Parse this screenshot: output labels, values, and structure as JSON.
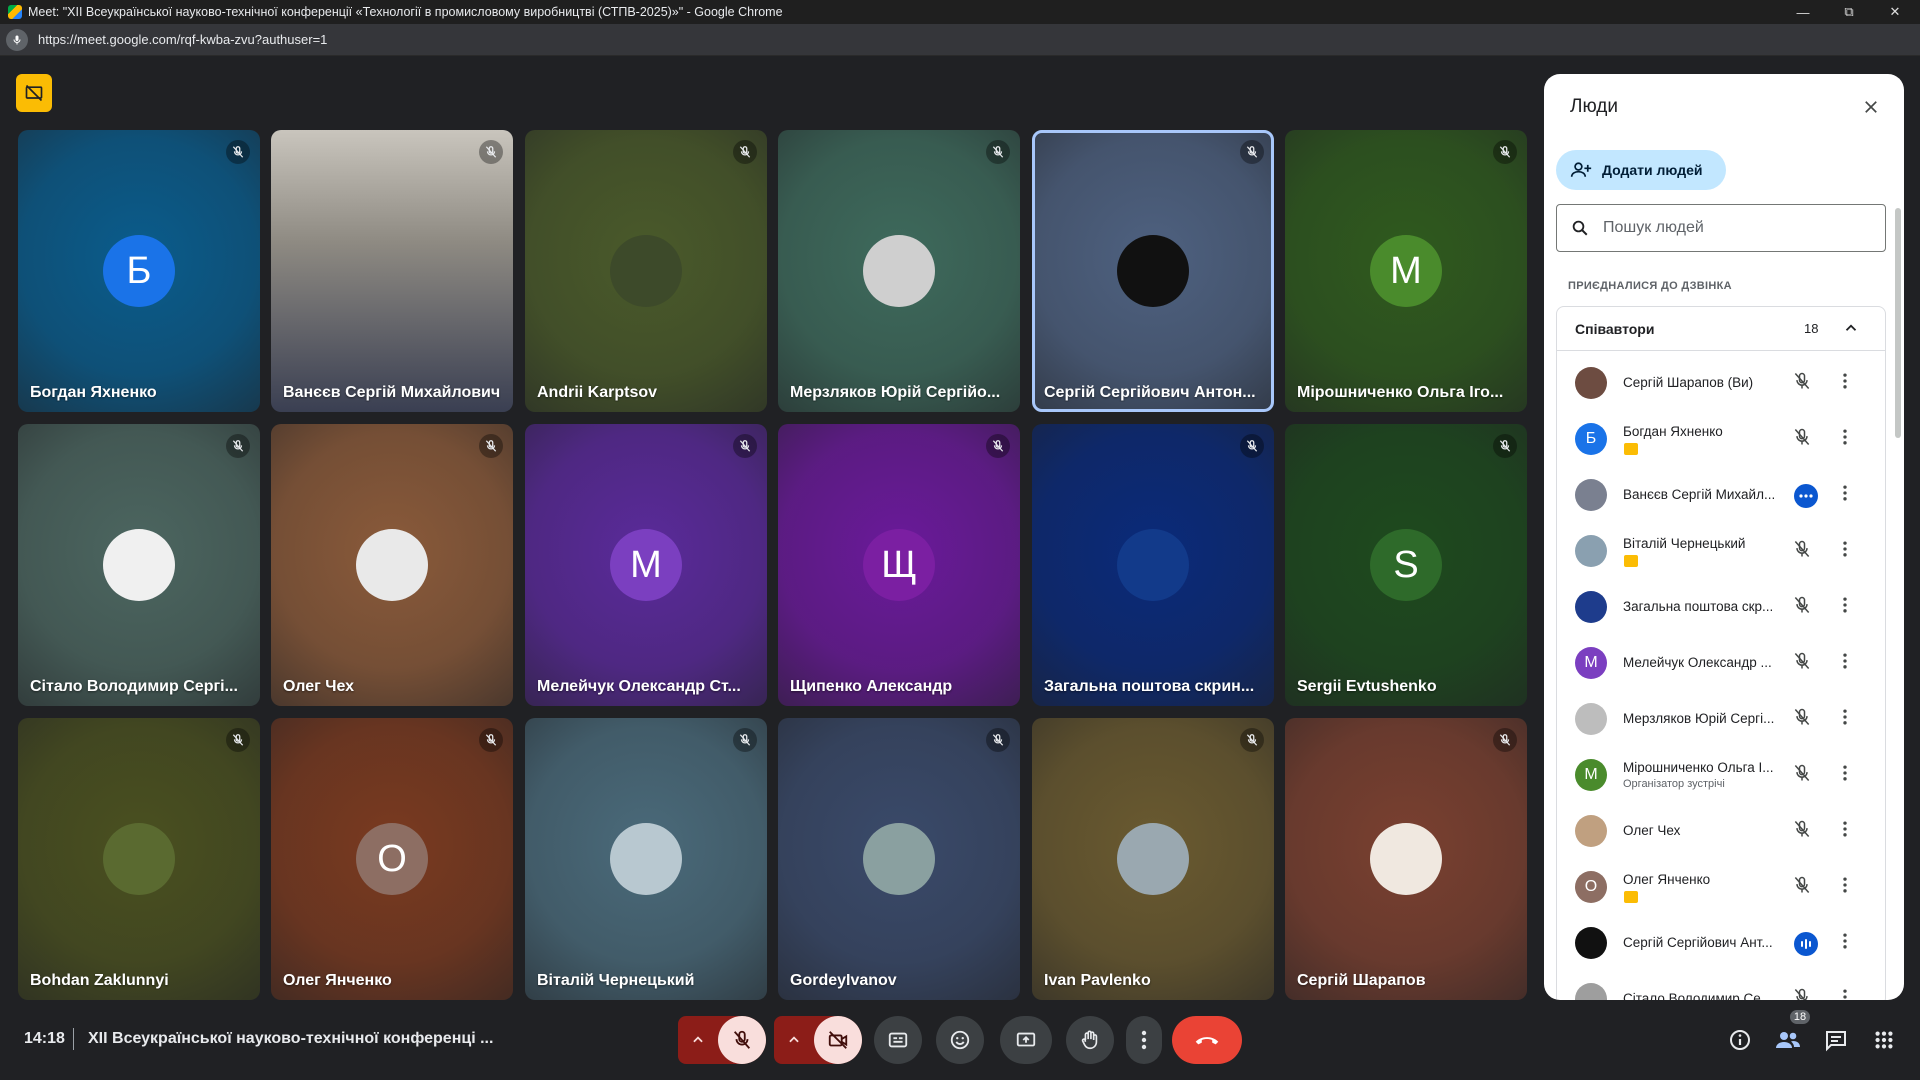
{
  "window": {
    "title": "Meet: \"XII Всеукраїнської науково-технічної конференції «Технології в промисловому виробництві (СТПВ-2025)»\" - Google Chrome",
    "url": "https://meet.google.com/rqf-kwba-zvu?authuser=1"
  },
  "tiles": [
    {
      "name": "Богдан Яхненко",
      "initial": "Б",
      "bg": "#0a5c8c",
      "avatar_color": "#1a73e8"
    },
    {
      "name": "Ванєєв Сергій Михайлович",
      "initial": "",
      "bg": "#8a8478",
      "avatar_color": ""
    },
    {
      "name": "Andrii Karptsov",
      "initial": "",
      "bg": "#4a5a2a",
      "avatar_color": "#3d4a2a"
    },
    {
      "name": "Мерзляков Юрій Сергійо...",
      "initial": "",
      "bg": "#3e6a5c",
      "avatar_color": "#cfcfcf"
    },
    {
      "name": "Сергій Сергійович Антон...",
      "initial": "",
      "bg": "#4e6180",
      "avatar_color": "#111111"
    },
    {
      "name": "Мірошниченко Ольга Іго...",
      "initial": "М",
      "bg": "#2f5a1e",
      "avatar_color": "#4a8b2c"
    },
    {
      "name": "Сітало Володимир Сергі...",
      "initial": "",
      "bg": "#4c6660",
      "avatar_color": "#f0f0f0"
    },
    {
      "name": "Олег Чех",
      "initial": "",
      "bg": "#8a5a3a",
      "avatar_color": "#e9e9e9"
    },
    {
      "name": "Мелейчук Олександр Ст...",
      "initial": "М",
      "bg": "#5a2a9a",
      "avatar_color": "#7b3fc0"
    },
    {
      "name": "Щипенко Александр",
      "initial": "Щ",
      "bg": "#6a1a9a",
      "avatar_color": "#7b1fa2"
    },
    {
      "name": "Загальна поштова скрин...",
      "initial": "",
      "bg": "#0a2a7a",
      "avatar_color": "#123a8a"
    },
    {
      "name": "Sergii Evtushenko",
      "initial": "S",
      "bg": "#1e4a1e",
      "avatar_color": "#2e6a2a"
    },
    {
      "name": "Bohdan Zaklunnyi",
      "initial": "",
      "bg": "#4a5020",
      "avatar_color": "#5a6a30"
    },
    {
      "name": "Олег Янченко",
      "initial": "О",
      "bg": "#7a3a20",
      "avatar_color": "#8d6e63"
    },
    {
      "name": "Віталій Чернецький",
      "initial": "",
      "bg": "#4a6a7a",
      "avatar_color": "#b8c8d0"
    },
    {
      "name": "GordeyIvanov",
      "initial": "",
      "bg": "#3a4a6a",
      "avatar_color": "#8aa0a0"
    },
    {
      "name": "Ivan Pavlenko",
      "initial": "",
      "bg": "#6a5a30",
      "avatar_color": "#9aa8b0"
    },
    {
      "name": "Сергій Шарапов",
      "initial": "",
      "bg": "#7a4030",
      "avatar_color": "#f0e8e0"
    }
  ],
  "bottom": {
    "time": "14:18",
    "meeting_name": "XII Всеукраїнської науково-технічної конференці ..."
  },
  "people_count_badge": "18",
  "panel": {
    "title": "Люди",
    "add_people": "Додати людей",
    "search_placeholder": "Пошук людей",
    "joined_label": "ПРИЄДНАЛИСЯ ДО ДЗВІНКА",
    "group_title": "Співавтори",
    "group_count": "18",
    "people": [
      {
        "name": "Сергій Шарапов (Ви)",
        "initial": "",
        "color": "#6d4c41",
        "sub": "",
        "badge": false,
        "state": "muted"
      },
      {
        "name": "Богдан Яхненко",
        "initial": "Б",
        "color": "#1a73e8",
        "sub": "",
        "badge": true,
        "state": "muted"
      },
      {
        "name": "Ванєєв Сергій Михайл...",
        "initial": "",
        "color": "#7a8090",
        "sub": "",
        "badge": false,
        "state": "dots"
      },
      {
        "name": "Віталій Чернецький",
        "initial": "",
        "color": "#8aa0b0",
        "sub": "",
        "badge": true,
        "state": "muted"
      },
      {
        "name": "Загальна поштова скр...",
        "initial": "",
        "color": "#1e3c8c",
        "sub": "",
        "badge": false,
        "state": "muted"
      },
      {
        "name": "Мелейчук Олександр ...",
        "initial": "М",
        "color": "#7b3fc0",
        "sub": "",
        "badge": false,
        "state": "muted"
      },
      {
        "name": "Мерзляков Юрій Сергі...",
        "initial": "",
        "color": "#bdbdbd",
        "sub": "",
        "badge": false,
        "state": "muted"
      },
      {
        "name": "Мірошниченко Ольга І...",
        "initial": "М",
        "color": "#4a8b2c",
        "sub": "Організатор зустрічі",
        "badge": false,
        "state": "muted"
      },
      {
        "name": "Олег Чех",
        "initial": "",
        "color": "#c0a080",
        "sub": "",
        "badge": false,
        "state": "muted"
      },
      {
        "name": "Олег Янченко",
        "initial": "О",
        "color": "#8d6e63",
        "sub": "",
        "badge": true,
        "state": "muted"
      },
      {
        "name": "Сергій Сергійович Ант...",
        "initial": "",
        "color": "#111111",
        "sub": "",
        "badge": false,
        "state": "speaking"
      },
      {
        "name": "Сітало Володимир Се...",
        "initial": "",
        "color": "#9e9e9e",
        "sub": "",
        "badge": false,
        "state": "muted"
      }
    ]
  },
  "colors": {
    "accent_blue": "#0b57d0",
    "end_call_red": "#ea4335",
    "warning_yellow": "#fbbc04"
  }
}
